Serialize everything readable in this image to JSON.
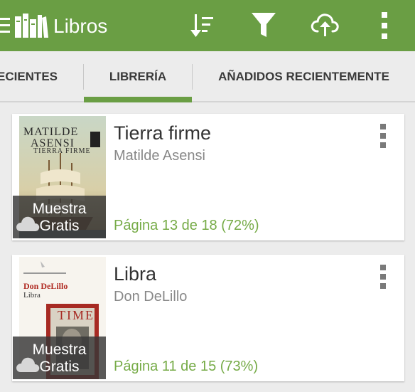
{
  "toolbar": {
    "title": "Libros",
    "icons": [
      "menu-icon",
      "books-icon",
      "sort-icon",
      "filter-icon",
      "cloud-upload-icon",
      "overflow-menu-icon"
    ],
    "color": "#6a9e44"
  },
  "tabs": [
    {
      "label": "RECIENTES",
      "active": false
    },
    {
      "label": "LIBRERÍA",
      "active": true
    },
    {
      "label": "AÑADIDOS RECIENTEMENTE",
      "active": false
    }
  ],
  "books": [
    {
      "title": "Tierra firme",
      "author": "Matilde Asensi",
      "progress": "Página 13 de 18 (72%)",
      "progress_fraction": 0.72,
      "sample_line1": "Muestra",
      "sample_line2": "Gratis",
      "cover": {
        "line1": "MATILDE",
        "line2": "ASENSI",
        "line3": "TIERRA FIRME"
      }
    },
    {
      "title": "Libra",
      "author": "Don DeLillo",
      "progress": "Página 11 de 15 (73%)",
      "progress_fraction": 0.73,
      "sample_line1": "Muestra",
      "sample_line2": "Gratis",
      "cover": {
        "line1": "Don DeLillo",
        "line2": "Libra",
        "line3": "TIME"
      }
    }
  ],
  "colors": {
    "accent": "#6a9e44",
    "progress_text": "#76ab47"
  }
}
